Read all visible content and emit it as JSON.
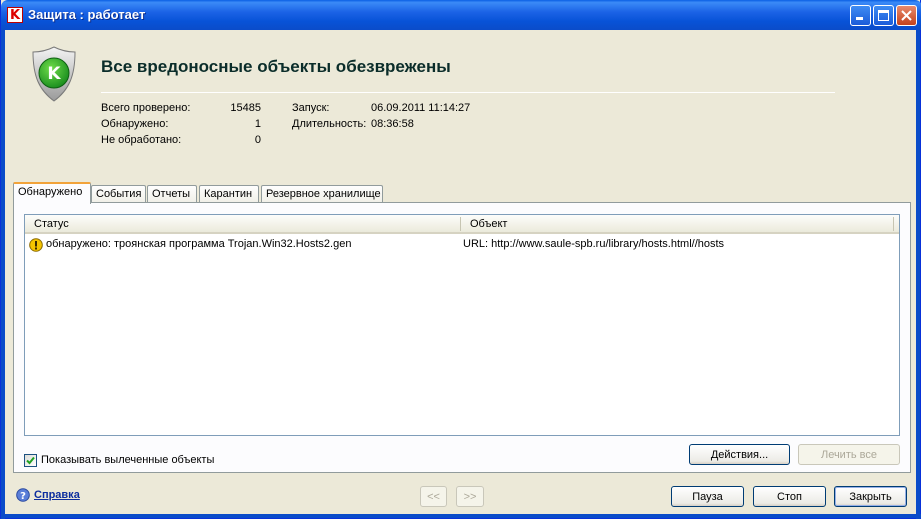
{
  "window": {
    "title": "Защита : работает",
    "logo_letter": "K",
    "controls": [
      "minimize-icon",
      "maximize-icon",
      "close-icon"
    ]
  },
  "header": {
    "headline": "Все вредоносные объекты обезврежены",
    "shield_letter": "K"
  },
  "stats": {
    "scanned_label": "Всего проверено:",
    "scanned_value": "15485",
    "detected_label": "Обнаружено:",
    "detected_value": "1",
    "unprocessed_label": "Не обработано:",
    "unprocessed_value": "0",
    "launch_label": "Запуск:",
    "launch_value": "06.09.2011 11:14:27",
    "duration_label": "Длительность:",
    "duration_value": "08:36:58"
  },
  "tabs": [
    {
      "label": "Обнаружено",
      "active": true
    },
    {
      "label": "События",
      "active": false
    },
    {
      "label": "Отчеты",
      "active": false
    },
    {
      "label": "Карантин",
      "active": false
    },
    {
      "label": "Резервное хранилище",
      "active": false
    }
  ],
  "table": {
    "columns": [
      "Статус",
      "Объект"
    ],
    "rows": [
      {
        "icon": "warning-icon",
        "status": "обнаружено: троянская программа Trojan.Win32.Hosts2.gen",
        "object": "URL: http://www.saule-spb.ru/library/hosts.html//hosts"
      }
    ]
  },
  "options": {
    "show_cured_label": "Показывать вылеченные объекты",
    "show_cured_checked": true
  },
  "buttons": {
    "actions": "Действия...",
    "cure_all": "Лечить все",
    "prev": "<<",
    "next": ">>",
    "pause": "Пауза",
    "stop": "Стоп",
    "close": "Закрыть"
  },
  "help": {
    "label": "Справка"
  },
  "colors": {
    "titlebar": "#0a4cc9",
    "window_bg": "#ece9d8",
    "shield_green": "#2aa52a",
    "warning": "#f5c400",
    "link": "#0d2e9e"
  }
}
